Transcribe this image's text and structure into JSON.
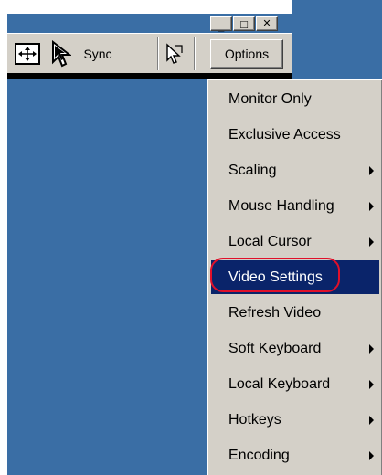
{
  "window": {
    "controls": [
      {
        "name": "minimize",
        "glyph": "_"
      },
      {
        "name": "maximize",
        "glyph": "□"
      },
      {
        "name": "close",
        "glyph": "✕"
      }
    ]
  },
  "toolbar": {
    "sync_label": "Sync",
    "options_label": "Options",
    "icons": [
      "fit-to-window-icon",
      "mouse-pointer-icon",
      "single-cursor-icon"
    ]
  },
  "menu": {
    "items": [
      {
        "label": "Monitor Only",
        "has_submenu": false,
        "selected": false
      },
      {
        "label": "Exclusive Access",
        "has_submenu": false,
        "selected": false
      },
      {
        "label": "Scaling",
        "has_submenu": true,
        "selected": false
      },
      {
        "label": "Mouse Handling",
        "has_submenu": true,
        "selected": false
      },
      {
        "label": "Local Cursor",
        "has_submenu": true,
        "selected": false
      },
      {
        "label": "Video Settings",
        "has_submenu": false,
        "selected": true
      },
      {
        "label": "Refresh Video",
        "has_submenu": false,
        "selected": false
      },
      {
        "label": "Soft Keyboard",
        "has_submenu": true,
        "selected": false
      },
      {
        "label": "Local Keyboard",
        "has_submenu": true,
        "selected": false
      },
      {
        "label": "Hotkeys",
        "has_submenu": true,
        "selected": false
      },
      {
        "label": "Encoding",
        "has_submenu": true,
        "selected": false
      }
    ]
  },
  "colors": {
    "desktop": "#3a6ea5",
    "chrome": "#d4d0c8",
    "selection": "#0a246a",
    "annotation": "#e0102a"
  }
}
